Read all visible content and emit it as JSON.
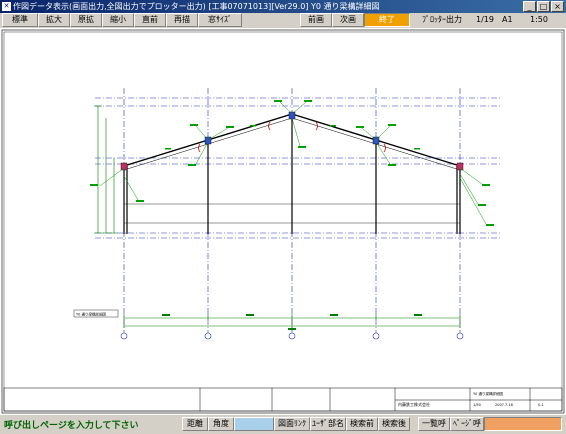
{
  "window": {
    "title": "作図データ表示(画面出力,全図出力でプロッター出力) [工事07071013][Ver29.0] Y0 通り梁構詳細図",
    "minimize": "_",
    "maximize": "□",
    "close": "×"
  },
  "toolbar": {
    "buttons": [
      "標準",
      "拡大",
      "原拡",
      "縮小",
      "直前",
      "再描",
      "窓ｻｲｽﾞ"
    ],
    "prev_page": "前画",
    "next_page": "次画",
    "exit": "終了",
    "plotter_output": "ﾌﾟﾛｯﾀｰ出力",
    "page_counter": "1/19",
    "paper_size": "A1",
    "scale": "1:50"
  },
  "drawing": {
    "caption": "Y0 通り梁構詳細図",
    "title_block": {
      "company": "内藤鉄工株式会社",
      "drawing_name": "Y0 通り梁構詳細図",
      "scale": "1/50",
      "date": "2007.7.18",
      "sheet": "S-1"
    }
  },
  "bottombar": {
    "prompt": "呼び出しページを入力して下さい",
    "buttons": [
      {
        "label": "距離",
        "style": "normal"
      },
      {
        "label": "角度",
        "style": "normal"
      },
      {
        "label": "",
        "style": "blue"
      },
      {
        "label": "図面ﾘﾝｸ",
        "style": "normal"
      },
      {
        "label": "ﾕｰｻﾞ部名",
        "style": "normal"
      },
      {
        "label": "検索前",
        "style": "normal"
      },
      {
        "label": "検索後",
        "style": "normal"
      },
      {
        "label": "一覧呼",
        "style": "normal"
      },
      {
        "label": "ﾍﾟｰｼﾞ呼",
        "style": "normal"
      },
      {
        "label": "",
        "style": "orange"
      }
    ]
  }
}
